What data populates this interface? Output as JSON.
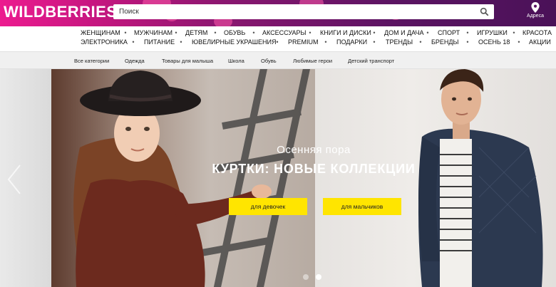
{
  "header": {
    "logo": "WILDBERRIES",
    "search_placeholder": "Поиск",
    "address_label": "Адреса"
  },
  "menu": {
    "row1": [
      "ЖЕНЩИНАМ",
      "МУЖЧИНАМ",
      "ДЕТЯМ",
      "ОБУВЬ",
      "АКСЕССУАРЫ",
      "КНИГИ И ДИСКИ",
      "ДОМ И ДАЧА",
      "СПОРТ",
      "ИГРУШКИ",
      "КРАСОТА"
    ],
    "row2": [
      "ЭЛЕКТРОНИКА",
      "ПИТАНИЕ",
      "ЮВЕЛИРНЫЕ УКРАШЕНИЯ",
      "PREMIUM",
      "ПОДАРКИ",
      "ТРЕНДЫ",
      "БРЕНДЫ",
      "ОСЕНЬ 18",
      "АКЦИИ"
    ],
    "separator": "•"
  },
  "submenu": [
    "Все категории",
    "Одежда",
    "Товары для малыша",
    "Школа",
    "Обувь",
    "Любимые герои",
    "Детский транспорт"
  ],
  "banner": {
    "subtitle": "Осенняя пора",
    "title": "КУРТКИ: НОВЫЕ КОЛЛЕКЦИИ",
    "button_girls": "для девочек",
    "button_boys": "для мальчиков",
    "slide_count": 2,
    "active_slide": 2
  },
  "colors": {
    "brand_pink": "#ec1b8f",
    "brand_purple": "#4a1158",
    "cta_yellow": "#ffe500"
  }
}
